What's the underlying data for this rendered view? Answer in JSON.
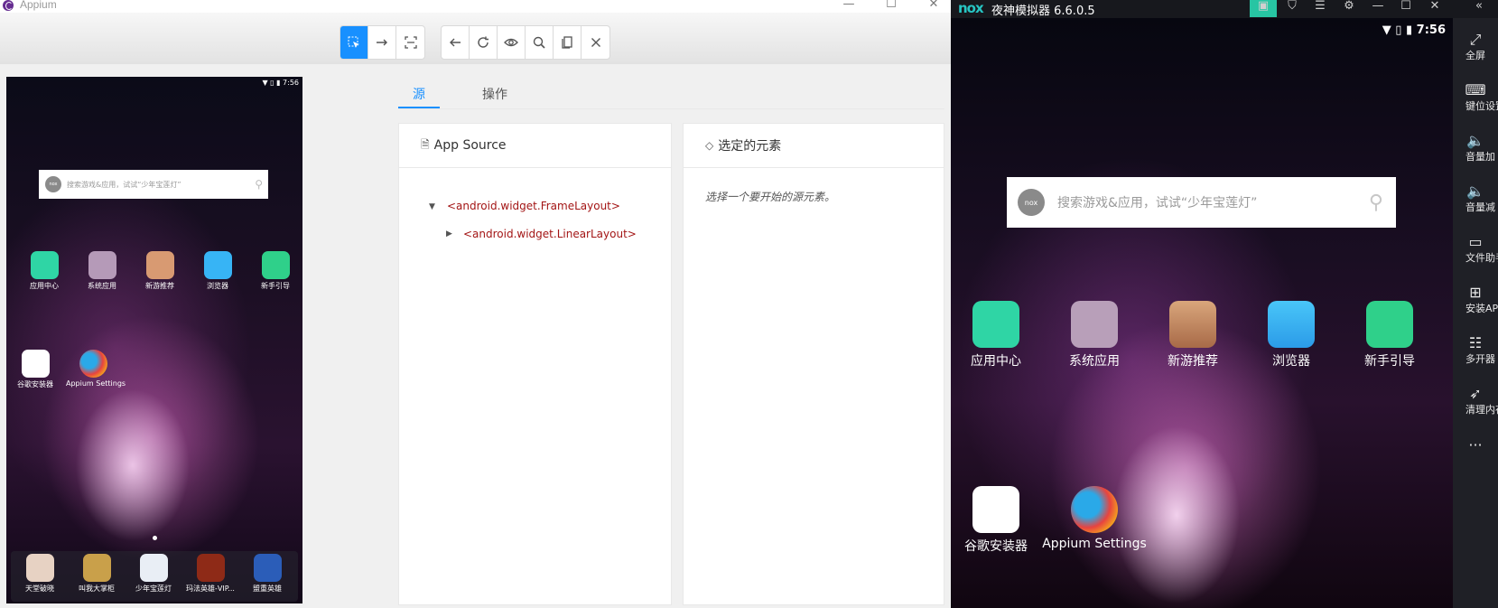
{
  "appium": {
    "title": "Appium",
    "window_controls": [
      "—",
      "☐",
      "✕"
    ],
    "toolbar": {
      "mode_buttons": [
        "select-elements",
        "swipe",
        "tap-by-coordinates"
      ],
      "action_buttons": [
        "back",
        "refresh",
        "show-hide",
        "search",
        "copy-xml",
        "quit"
      ]
    },
    "device_screenshot": {
      "status_time": "7:56",
      "search_placeholder": "搜索游戏&应用，试试“少年宝莲灯”",
      "apps_row1": [
        "应用中心",
        "系统应用",
        "新游推荐",
        "浏览器",
        "新手引导"
      ],
      "apps_row2": [
        "谷歌安装器",
        "Appium Settings"
      ],
      "dock": [
        "天堂破晓",
        "叫我大掌柜",
        "少年宝莲灯",
        "玛法英雄-VIP...",
        "盟重英雄"
      ]
    },
    "tabs": [
      "源",
      "操作"
    ],
    "source_panel": {
      "title": "App Source",
      "nodes": [
        "<android.widget.FrameLayout>",
        "<android.widget.LinearLayout>"
      ]
    },
    "selected_panel": {
      "title": "选定的元素",
      "placeholder": "选择一个要开始的源元素。"
    }
  },
  "nox": {
    "title": "夜神模拟器 6.6.0.5",
    "logo": "nox",
    "accent": "#27c5a3",
    "status_time": "7:56",
    "search_placeholder": "搜索游戏&应用，试试“少年宝莲灯”",
    "apps_row1": [
      "应用中心",
      "系统应用",
      "新游推荐",
      "浏览器",
      "新手引导"
    ],
    "apps_row2": [
      "谷歌安装器",
      "Appium Settings"
    ],
    "sidebar": [
      "全屏",
      "键位设置",
      "音量加",
      "音量减",
      "文件助手",
      "安装APK",
      "多开器",
      "清理内存"
    ],
    "sidebar_more": "···",
    "collapse": "«"
  }
}
